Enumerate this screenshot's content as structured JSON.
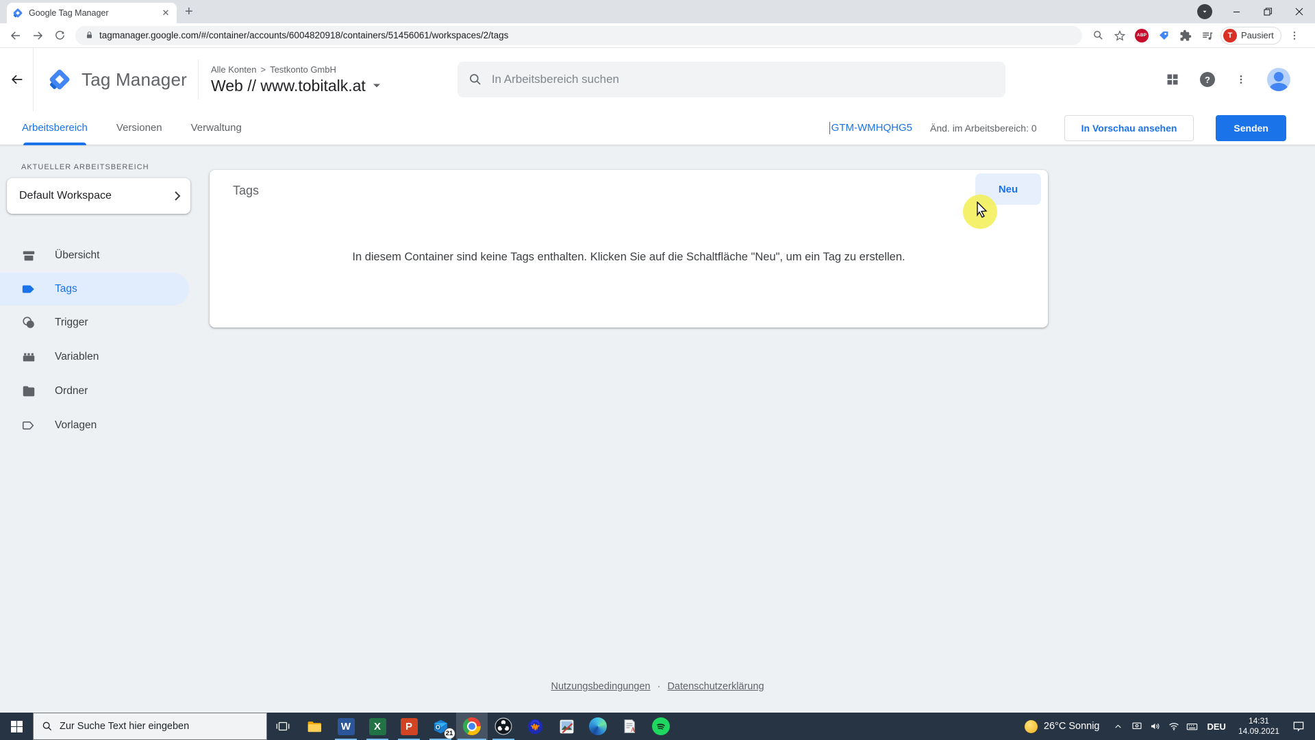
{
  "browser": {
    "tab_title": "Google Tag Manager",
    "url": "tagmanager.google.com/#/container/accounts/6004820918/containers/51456061/workspaces/2/tags",
    "abp_label": "ABP",
    "profile": {
      "initial": "T",
      "label": "Pausiert"
    }
  },
  "header": {
    "product": "Tag Manager",
    "breadcrumb": {
      "root": "Alle Konten",
      "separator": ">",
      "account": "Testkonto GmbH"
    },
    "container_title": "Web // www.tobitalk.at",
    "search_placeholder": "In Arbeitsbereich suchen",
    "help_glyph": "?"
  },
  "nav": {
    "tabs": [
      "Arbeitsbereich",
      "Versionen",
      "Verwaltung"
    ],
    "container_id": "GTM-WMHQHG5",
    "changes_label": "Änd. im Arbeitsbereich: 0",
    "preview_button": "In Vorschau ansehen",
    "submit_button": "Senden"
  },
  "sidebar": {
    "section_label": "AKTUELLER ARBEITSBEREICH",
    "workspace_name": "Default Workspace",
    "items": [
      {
        "label": "Übersicht"
      },
      {
        "label": "Tags"
      },
      {
        "label": "Trigger"
      },
      {
        "label": "Variablen"
      },
      {
        "label": "Ordner"
      },
      {
        "label": "Vorlagen"
      }
    ]
  },
  "main": {
    "card_title": "Tags",
    "new_button": "Neu",
    "empty_message": "In diesem Container sind keine Tags enthalten. Klicken Sie auf die Schaltfläche \"Neu\", um ein Tag zu erstellen."
  },
  "footer": {
    "terms": "Nutzungsbedingungen",
    "separator": "·",
    "privacy": "Datenschutzerklärung"
  },
  "taskbar": {
    "search_placeholder": "Zur Suche Text hier eingeben",
    "outlook_badge": "21",
    "tray": {
      "weather": "26°C Sonnig",
      "language": "DEU",
      "time": "14:31",
      "date": "14.09.2021"
    }
  },
  "colors": {
    "accent": "#1a73e8",
    "active_item_bg": "#e1ecfd",
    "neu_bg": "#e7effd",
    "taskbar_bg": "#263444"
  }
}
